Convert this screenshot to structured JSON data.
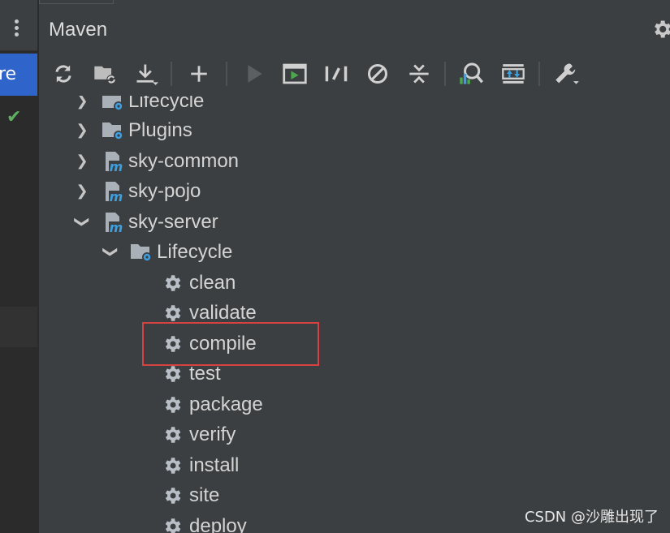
{
  "left_panel": {
    "selected_item_fragment": "re"
  },
  "tool_window": {
    "title": "Maven"
  },
  "toolbar": {
    "buttons": [
      {
        "name": "reload-all-icon"
      },
      {
        "name": "generate-sources-icon"
      },
      {
        "name": "download-icon"
      },
      {
        "name": "add-icon"
      },
      {
        "name": "run-icon"
      },
      {
        "name": "execute-goal-icon"
      },
      {
        "name": "toggle-offline-icon"
      },
      {
        "name": "skip-tests-icon"
      },
      {
        "name": "collapse-all-icon"
      },
      {
        "name": "analyze-dependencies-icon"
      },
      {
        "name": "show-diagram-icon"
      },
      {
        "name": "settings-wrench-icon"
      }
    ]
  },
  "tree": {
    "items": [
      {
        "label": "Lifecycle",
        "type": "folder",
        "expanded": false
      },
      {
        "label": "Plugins",
        "type": "folder",
        "expanded": false
      },
      {
        "label": "sky-common",
        "type": "module",
        "expanded": false
      },
      {
        "label": "sky-pojo",
        "type": "module",
        "expanded": false
      },
      {
        "label": "sky-server",
        "type": "module",
        "expanded": true
      },
      {
        "label": "Lifecycle",
        "type": "folder",
        "expanded": true
      },
      {
        "label": "clean",
        "type": "goal"
      },
      {
        "label": "validate",
        "type": "goal"
      },
      {
        "label": "compile",
        "type": "goal",
        "highlighted": true
      },
      {
        "label": "test",
        "type": "goal"
      },
      {
        "label": "package",
        "type": "goal"
      },
      {
        "label": "verify",
        "type": "goal"
      },
      {
        "label": "install",
        "type": "goal"
      },
      {
        "label": "site",
        "type": "goal"
      },
      {
        "label": "deploy",
        "type": "goal"
      }
    ]
  },
  "watermark": "CSDN @沙雕出现了",
  "colors": {
    "accent_blue": "#2f65ca",
    "highlight_box": "#d64242",
    "icon_gear_blue": "#3d9ee0",
    "check_green": "#5fb05f"
  }
}
